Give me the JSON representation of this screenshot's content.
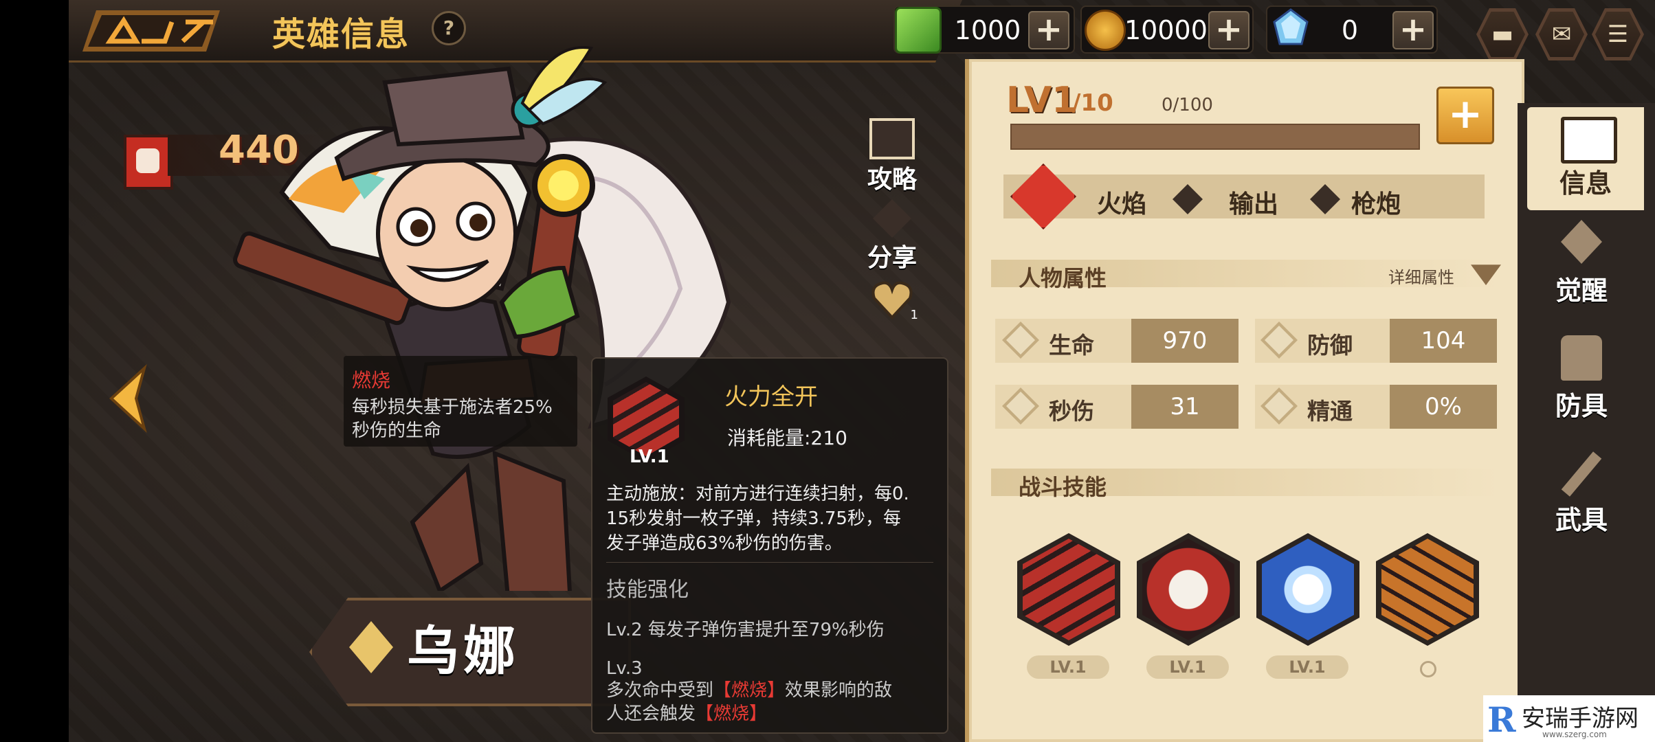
{
  "header": {
    "title": "英雄信息",
    "help": "?"
  },
  "resources": {
    "gems": "1000",
    "coins": "10000",
    "crystals": "0",
    "plus": "+"
  },
  "hero": {
    "power": "440",
    "name": "乌娜"
  },
  "side_actions": [
    {
      "label": "攻略"
    },
    {
      "label": "分享"
    },
    {
      "label": "1"
    }
  ],
  "burn_tip": {
    "title": "燃烧",
    "desc_line1": "每秒损失基于施法者25%",
    "desc_line2": "秒伤的生命"
  },
  "skill_tip": {
    "name": "火力全开",
    "level": "LV.1",
    "cost": "消耗能量:210",
    "desc_line1": "主动施放：对前方进行连续扫射，每0.",
    "desc_line2": "15秒发射一枚子弹，持续3.75秒，每",
    "desc_line3": "发子弹造成63%秒伤的伤害。",
    "enhance_title": "技能强化",
    "lv2": "Lv.2  每发子弹伤害提升至79%秒伤",
    "lv3_label": "Lv.3",
    "lv3_line1_a": "多次命中受到",
    "lv3_burn": "【燃烧】",
    "lv3_line1_b": "效果影响的敌",
    "lv3_line2_a": "人还会触发",
    "lv3_burn2": "【燃烧】"
  },
  "level": {
    "lv_label": "LV1",
    "max": "/10",
    "exp": "0/100",
    "exp_fraction": 0
  },
  "tags": [
    {
      "label": "火焰"
    },
    {
      "label": "输出"
    },
    {
      "label": "枪炮"
    }
  ],
  "attributes": {
    "header": "人物属性",
    "detail": "详细属性",
    "stats": [
      {
        "label": "生命",
        "value": "970"
      },
      {
        "label": "防御",
        "value": "104"
      },
      {
        "label": "秒伤",
        "value": "31"
      },
      {
        "label": "精通",
        "value": "0%"
      }
    ]
  },
  "skills": {
    "header": "战斗技能",
    "items": [
      {
        "level": "LV.1",
        "color": "#b8312a"
      },
      {
        "level": "LV.1",
        "color": "#b8312a"
      },
      {
        "level": "LV.1",
        "color": "#2f5fc0"
      },
      {
        "level": "",
        "color": "#c8742a"
      }
    ]
  },
  "tabs": [
    {
      "label": "信息"
    },
    {
      "label": "觉醒"
    },
    {
      "label": "防具"
    },
    {
      "label": "武具"
    }
  ],
  "watermark": {
    "text": "安瑞手游网",
    "url": "www.szerg.com"
  },
  "colors": {
    "accent": "#f3c55a",
    "fire": "#d8382c",
    "panel": "#f2e3c2"
  }
}
